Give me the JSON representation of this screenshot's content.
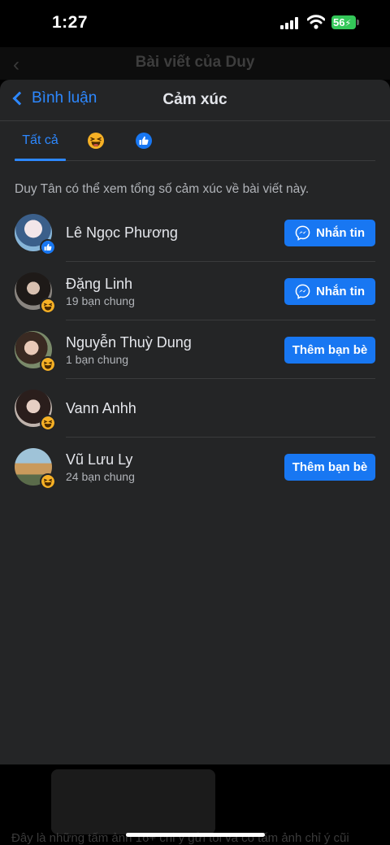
{
  "status": {
    "time": "1:27",
    "battery": "56"
  },
  "background": {
    "title": "Bài viết của Duy",
    "caption": "Đây là những tấm ảnh 16+ chỉ ý gửi tôi và có tấm ảnh chỉ ý cũi"
  },
  "sheet": {
    "back_label": "Bình luận",
    "title": "Cảm xúc",
    "tabs": {
      "all": "Tất cả",
      "haha_icon": "haha-emoji-icon",
      "like_icon": "like-thumb-icon"
    },
    "info": "Duy Tân có thể xem tổng số cảm xúc về bài viết này."
  },
  "colors": {
    "accent": "#1877f2",
    "link": "#2d88ff",
    "sheet_bg": "#242526",
    "haha": "#f7b125",
    "like": "#1877f2"
  },
  "people": [
    {
      "name": "Lê Ngọc Phương",
      "mutual": "",
      "reaction": "like",
      "button": "Nhắn tin",
      "button_type": "message"
    },
    {
      "name": "Đặng Linh",
      "mutual": "19 bạn chung",
      "reaction": "haha",
      "button": "Nhắn tin",
      "button_type": "message"
    },
    {
      "name": "Nguyễn Thuỳ Dung",
      "mutual": "1 bạn chung",
      "reaction": "haha",
      "button": "Thêm bạn bè",
      "button_type": "add"
    },
    {
      "name": "Vann Anhh",
      "mutual": "",
      "reaction": "haha",
      "button": "",
      "button_type": "none"
    },
    {
      "name": "Vũ Lưu Ly",
      "mutual": "24 bạn chung",
      "reaction": "haha",
      "button": "Thêm bạn bè",
      "button_type": "add"
    }
  ]
}
